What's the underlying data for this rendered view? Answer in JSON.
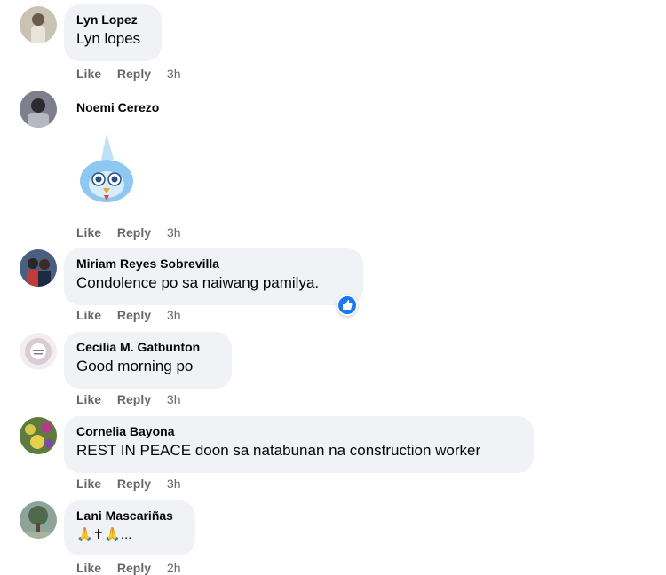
{
  "comments": [
    {
      "author": "Lyn Lopez",
      "text": "Lyn lopes",
      "like": "Like",
      "reply": "Reply",
      "time": "3h"
    },
    {
      "author": "Noemi Cerezo",
      "text": "",
      "like": "Like",
      "reply": "Reply",
      "time": "3h",
      "sticker": "blue-bird-sticker"
    },
    {
      "author": "Miriam Reyes Sobrevilla",
      "text": "Condolence po sa naiwang pamilya.",
      "like": "Like",
      "reply": "Reply",
      "time": "3h",
      "reaction": "like-reaction-icon"
    },
    {
      "author": "Cecilia M. Gatbunton",
      "text": "Good morning po",
      "like": "Like",
      "reply": "Reply",
      "time": "3h"
    },
    {
      "author": "Cornelia Bayona",
      "text": "REST IN PEACE doon sa natabunan na construction worker",
      "like": "Like",
      "reply": "Reply",
      "time": "3h"
    },
    {
      "author": "Lani Mascariñas",
      "text": "🙏✝🙏...",
      "like": "Like",
      "reply": "Reply",
      "time": "2h"
    }
  ],
  "colors": {
    "bubble": "#f0f2f5",
    "meta": "#65676b",
    "like_blue": "#1877f2"
  }
}
